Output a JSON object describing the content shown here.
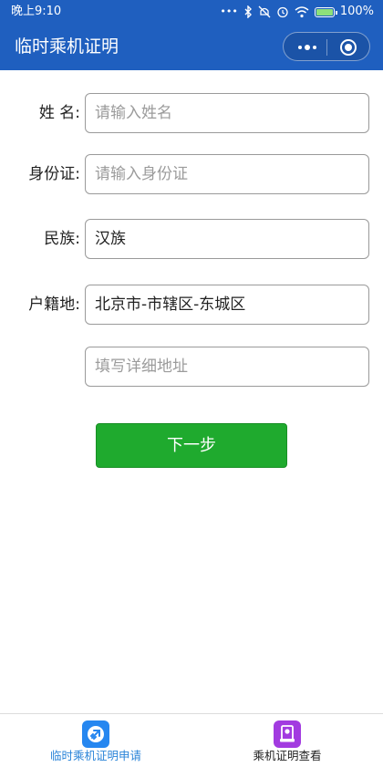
{
  "status_bar": {
    "time": "晚上9:10",
    "battery": "100%",
    "icons": [
      "more-dots-icon",
      "bluetooth-icon",
      "mute-icon",
      "alarm-icon",
      "wifi-icon",
      "battery-icon"
    ]
  },
  "nav": {
    "title": "临时乘机证明"
  },
  "form": {
    "name_label": "姓 名:",
    "name_placeholder": "请输入姓名",
    "id_label": "身份证:",
    "id_placeholder": "请输入身份证",
    "ethnicity_label": "民族:",
    "ethnicity_value": "汉族",
    "household_label": "户籍地:",
    "household_value": "北京市-市辖区-东城区",
    "address_placeholder": "填写详细地址"
  },
  "actions": {
    "next_label": "下一步"
  },
  "tabbar": {
    "tabs": [
      {
        "label": "临时乘机证明申请",
        "icon": "airplane-icon",
        "active": true
      },
      {
        "label": "乘机证明查看",
        "icon": "certificate-icon",
        "active": false
      }
    ]
  },
  "colors": {
    "nav_bg": "#1f5fbf",
    "primary_button": "#1faa2e",
    "tab_active": "#2b84d8",
    "tab1_icon_bg": "#2687f0",
    "tab2_icon_bg": "#a23be0"
  }
}
